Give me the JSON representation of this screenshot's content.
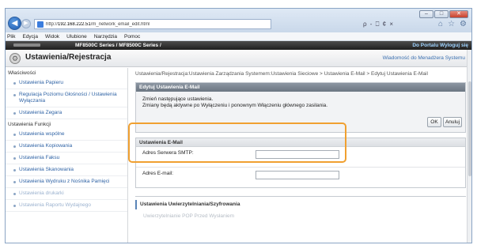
{
  "browser": {
    "url_host": "192.168.222.51",
    "url_prefix": "http://",
    "url_path": "/m_network_email_edit.html",
    "addr_tools": "ρ - ⎕ ¢ ×"
  },
  "menu": [
    "Plik",
    "Edycja",
    "Widok",
    "Ulubione",
    "Narzędzia",
    "Pomoc"
  ],
  "device": {
    "model": "MF8500C Series / MF8500C Series /",
    "portal_link": "Do Portalu   Wyloguj się"
  },
  "header": {
    "title": "Ustawienia/Rejestracja",
    "manager_link": "Wiadomość do Menadżera Systemu"
  },
  "sidebar": {
    "section1": "Właściwości",
    "items1": [
      "Ustawienia Papieru",
      "Regulacja Poziomu Głośności / Ustawienia Wyłączania",
      "Ustawienia Zegara"
    ],
    "section2": "Ustawienia Funkcji",
    "items2": [
      "Ustawienia wspólne",
      "Ustawienia Kopiowania",
      "Ustawienia Faksu",
      "Ustawienia Skanowania",
      "Ustawienia Wydruku z Nośnika Pamięci",
      "Ustawienia drukarki",
      "Ustawienia Raportu Wydajnego"
    ]
  },
  "main": {
    "breadcrumb": "Ustawienia/Rejestracja:Ustawienia Zarządzania Systemem:Ustawienia Sieciowe > Ustawienia E-Mail > Edytuj Ustawienia E-Mail",
    "edit_title": "Edytuj Ustawienia E-Mail",
    "msg_line1": "Zmień następujące ustawienia.",
    "msg_line2": "Zmiany będą aktywne po Wyłączeniu i ponownym Włączeniu głównego zasilania.",
    "ok_label": "OK",
    "cancel_label": "Anuluj",
    "email_section_title": "Ustawienia E-Mail",
    "smtp_label": "Adres Serwera SMTP:",
    "smtp_value": "",
    "email_label": "Adres E-mail:",
    "email_value": "",
    "cert_section_title": "Ustawienia Uwierzytelniania/Szyfrowania",
    "cert_faded": "Uwierzytelnianie POP Przed Wysłaniem"
  },
  "colors": {
    "highlight": "#f0a030",
    "link": "#2f63a5",
    "dark_bar": "#6c7682"
  }
}
